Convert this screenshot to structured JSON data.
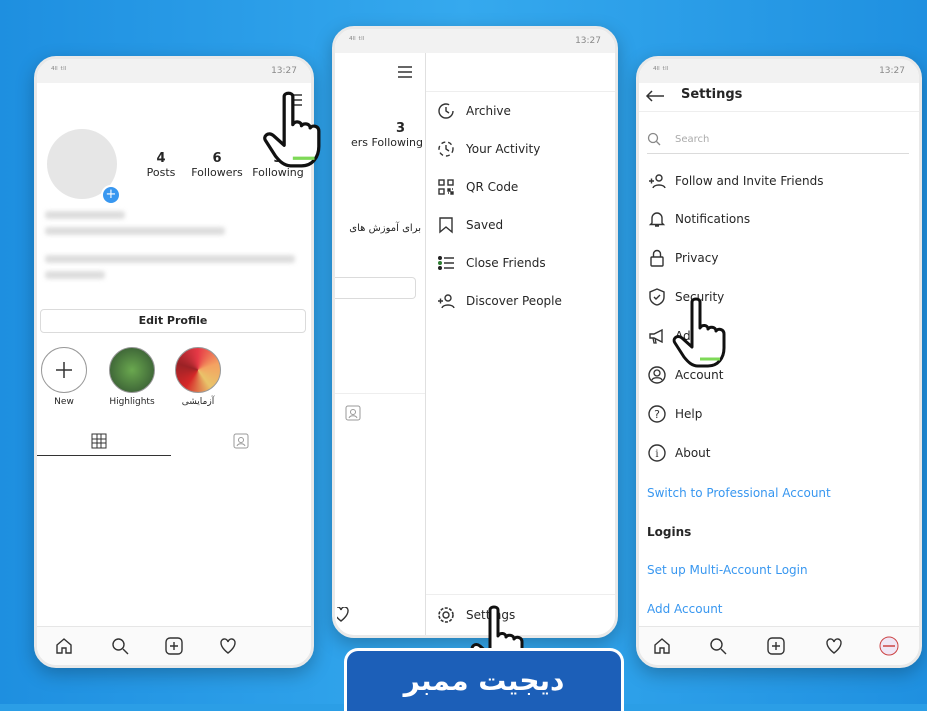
{
  "phone1": {
    "status_time": "13:27",
    "stats": [
      {
        "num": "4",
        "label": "Posts"
      },
      {
        "num": "6",
        "label": "Followers"
      },
      {
        "num": "3",
        "label": "Following"
      }
    ],
    "edit_profile": "Edit Profile",
    "highlights": [
      {
        "label": "New"
      },
      {
        "label": "Highlights"
      },
      {
        "label": "آزمایشی"
      }
    ]
  },
  "phone2": {
    "status_time": "13:27",
    "following_num": "3",
    "following_frag": "ers  Following",
    "bio_frag": "برای آموزش های",
    "menu": [
      {
        "label": "Archive",
        "icon": "archive-icon"
      },
      {
        "label": "Your Activity",
        "icon": "activity-icon"
      },
      {
        "label": "QR Code",
        "icon": "qr-code-icon"
      },
      {
        "label": "Saved",
        "icon": "bookmark-icon"
      },
      {
        "label": "Close Friends",
        "icon": "close-friends-icon"
      },
      {
        "label": "Discover People",
        "icon": "add-person-icon"
      }
    ],
    "settings_label": "Settings"
  },
  "phone3": {
    "status_time": "13:27",
    "title": "Settings",
    "search_placeholder": "Search",
    "items": [
      {
        "label": "Follow and Invite Friends"
      },
      {
        "label": "Notifications"
      },
      {
        "label": "Privacy"
      },
      {
        "label": "Security"
      },
      {
        "label": "Ads"
      },
      {
        "label": "Account"
      },
      {
        "label": "Help"
      },
      {
        "label": "About"
      }
    ],
    "switch_pro": "Switch to Professional Account",
    "logins": "Logins",
    "multi_login": "Set up Multi-Account Login",
    "add_account": "Add Account"
  },
  "brand": "دیجیت ممبر",
  "colors": {
    "accent": "#3897f0",
    "background": "#2b9ee6",
    "brand": "#1c5fb8"
  }
}
